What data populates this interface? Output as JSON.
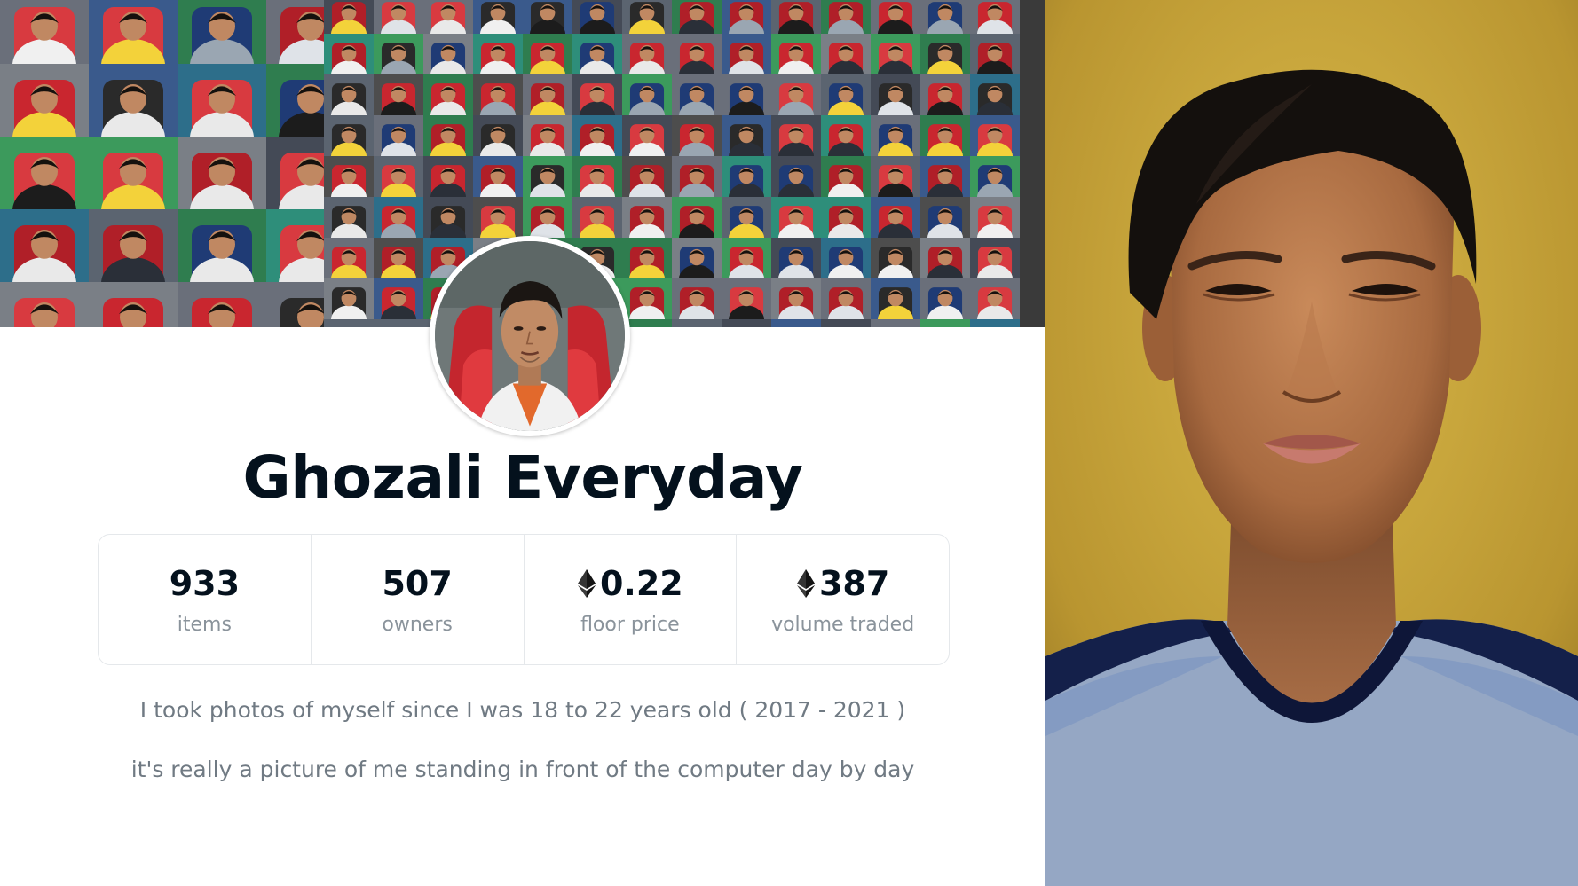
{
  "collection": {
    "title": "Ghozali Everyday"
  },
  "stats": [
    {
      "value": "933",
      "label": "items",
      "icon": ""
    },
    {
      "value": "507",
      "label": "owners",
      "icon": ""
    },
    {
      "value": "0.22",
      "label": "floor price",
      "icon": "ethereum-icon"
    },
    {
      "value": "387",
      "label": "volume traded",
      "icon": "ethereum-icon"
    }
  ],
  "description": {
    "line1": "I took photos of myself since I was 18 to 22 years old ( 2017 - 2021 )",
    "line2": "it's really a picture of me standing in front of the computer day by day"
  },
  "colors": {
    "title": "#04111d",
    "stat_label": "#8a939b",
    "description": "#707a83",
    "border": "#e5e8eb",
    "selfie_wall": "#c9a63a"
  }
}
